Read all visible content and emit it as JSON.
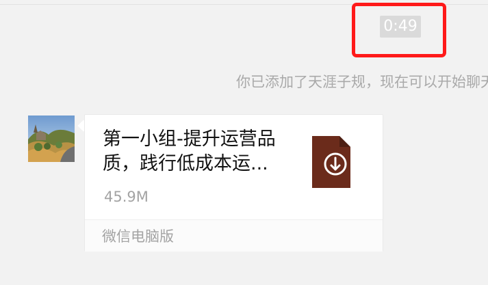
{
  "chat": {
    "timestamp": "0:49",
    "system_message": "你已添加了天涯子规，现在可以开始聊天了",
    "file_message": {
      "file_name": "第一小组-提升运营品质，践行低成本运...",
      "file_size": "45.9M",
      "source_label": "微信电脑版",
      "icon": "download-arrow-icon",
      "icon_color": "#6b2b1b"
    }
  },
  "colors": {
    "background": "#f2f2f2",
    "highlight": "#ff1a1a",
    "timestamp_badge": "#dadada"
  }
}
